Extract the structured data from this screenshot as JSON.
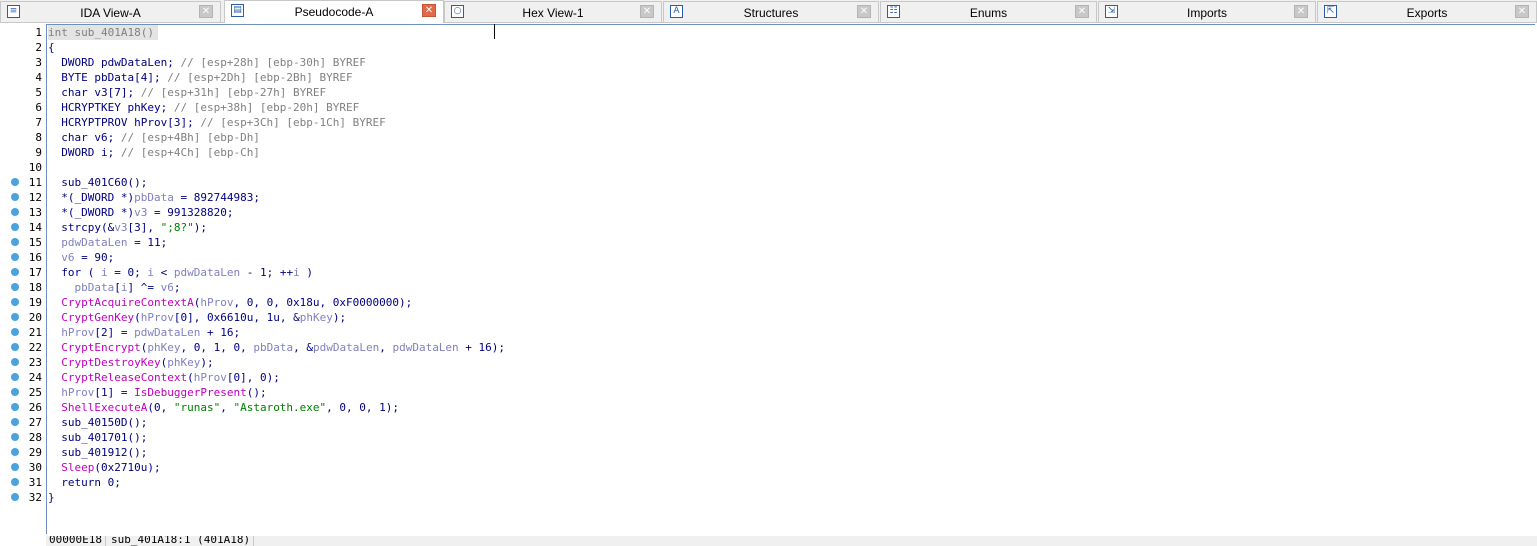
{
  "tabs": [
    {
      "label": "IDA View-A",
      "icon": "ida-view-icon",
      "active": false
    },
    {
      "label": "Pseudocode-A",
      "icon": "pseudocode-icon",
      "active": true
    },
    {
      "label": "Hex View-1",
      "icon": "hex-view-icon",
      "active": false
    },
    {
      "label": "Structures",
      "icon": "structures-icon",
      "active": false
    },
    {
      "label": "Enums",
      "icon": "enums-icon",
      "active": false
    },
    {
      "label": "Imports",
      "icon": "imports-icon",
      "active": false
    },
    {
      "label": "Exports",
      "icon": "exports-icon",
      "active": false
    }
  ],
  "colors": {
    "keyword": "#000080",
    "comment": "#808080",
    "variable": "#8080c0",
    "function_api": "#c000c0",
    "string": "#008000",
    "gutter_dot": "#4aa3df"
  },
  "code": [
    "int sub_401A18()",
    "{",
    "  DWORD pdwDataLen; // [esp+28h] [ebp-30h] BYREF",
    "  BYTE pbData[4]; // [esp+2Dh] [ebp-2Bh] BYREF",
    "  char v3[7]; // [esp+31h] [ebp-27h] BYREF",
    "  HCRYPTKEY phKey; // [esp+38h] [ebp-20h] BYREF",
    "  HCRYPTPROV hProv[3]; // [esp+3Ch] [ebp-1Ch] BYREF",
    "  char v6; // [esp+4Bh] [ebp-Dh]",
    "  DWORD i; // [esp+4Ch] [ebp-Ch]",
    "",
    "  sub_401C60();",
    "  *(_DWORD *)pbData = 892744983;",
    "  *(_DWORD *)v3 = 991328820;",
    "  strcpy(&v3[3], \";8?\");",
    "  pdwDataLen = 11;",
    "  v6 = 90;",
    "  for ( i = 0; i < pdwDataLen - 1; ++i )",
    "    pbData[i] ^= v6;",
    "  CryptAcquireContextA(hProv, 0, 0, 0x18u, 0xF0000000);",
    "  CryptGenKey(hProv[0], 0x6610u, 1u, &phKey);",
    "  hProv[2] = pdwDataLen + 16;",
    "  CryptEncrypt(phKey, 0, 1, 0, pbData, &pdwDataLen, pdwDataLen + 16);",
    "  CryptDestroyKey(phKey);",
    "  CryptReleaseContext(hProv[0], 0);",
    "  hProv[1] = IsDebuggerPresent();",
    "  ShellExecuteA(0, \"runas\", \"Astaroth.exe\", 0, 0, 1);",
    "  sub_40150D();",
    "  sub_401701();",
    "  sub_401912();",
    "  Sleep(0x2710u);",
    "  return 0;",
    "}"
  ],
  "breakpoint_lines": [
    11,
    12,
    13,
    14,
    15,
    16,
    17,
    18,
    19,
    20,
    21,
    22,
    23,
    24,
    25,
    26,
    27,
    28,
    29,
    30,
    31,
    32
  ],
  "statusbar": {
    "address": "00000E18",
    "location": "sub_401A18:1 (401A18)"
  }
}
